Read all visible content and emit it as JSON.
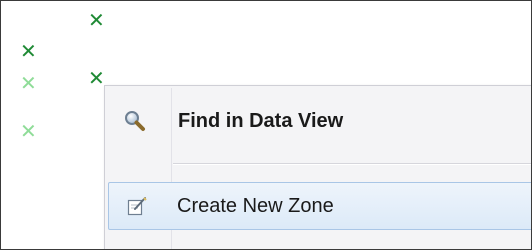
{
  "map": {
    "marker_glyph": "✕",
    "colors": {
      "marker_dark": "#1f8a35",
      "marker_light": "#8fdc98"
    }
  },
  "context_menu": {
    "items": [
      {
        "label": "Find in Data View",
        "icon": "magnifier-icon",
        "bold": true
      },
      {
        "label": "Create New Zone",
        "icon": "edit-zone-icon",
        "bold": false,
        "highlighted": true
      }
    ]
  }
}
